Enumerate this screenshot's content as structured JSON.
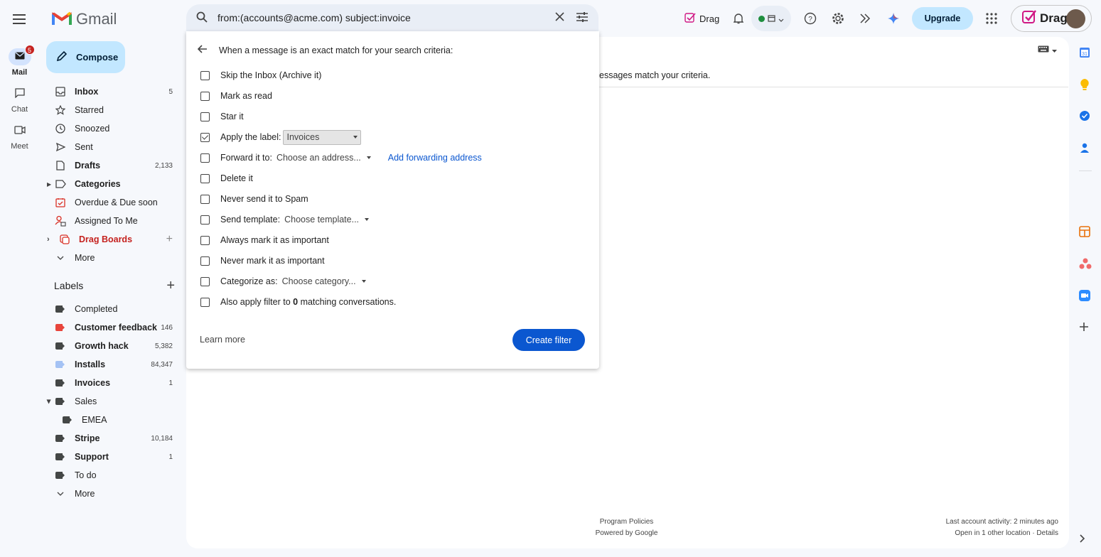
{
  "app": {
    "name": "Gmail"
  },
  "rail": [
    {
      "label": "Mail",
      "badge": "5",
      "icon": "mail-icon"
    },
    {
      "label": "Chat",
      "icon": "chat-icon"
    },
    {
      "label": "Meet",
      "icon": "video-icon"
    }
  ],
  "compose_label": "Compose",
  "nav": [
    {
      "label": "Inbox",
      "count": "5",
      "bold": true
    },
    {
      "label": "Starred"
    },
    {
      "label": "Snoozed"
    },
    {
      "label": "Sent"
    },
    {
      "label": "Drafts",
      "count": "2,133",
      "bold": true
    },
    {
      "label": "Categories",
      "bold": true
    },
    {
      "label": "Overdue & Due soon"
    },
    {
      "label": "Assigned To Me"
    },
    {
      "label": "Drag Boards"
    },
    {
      "label": "More"
    }
  ],
  "labels_header": "Labels",
  "labels": [
    {
      "label": "Completed",
      "color": "#444746"
    },
    {
      "label": "Customer feedback",
      "count": "146",
      "color": "#e8453c",
      "bold": true
    },
    {
      "label": "Growth hack",
      "count": "5,382",
      "color": "#444746",
      "bold": true
    },
    {
      "label": "Installs",
      "count": "84,347",
      "color": "#a4c2f4",
      "bold": true
    },
    {
      "label": "Invoices",
      "count": "1",
      "color": "#444746",
      "bold": true
    },
    {
      "label": "Sales",
      "color": "#444746"
    },
    {
      "label": "EMEA",
      "color": "#444746"
    },
    {
      "label": "Stripe",
      "count": "10,184",
      "color": "#444746",
      "bold": true
    },
    {
      "label": "Support",
      "count": "1",
      "color": "#444746",
      "bold": true
    },
    {
      "label": "To do",
      "color": "#444746"
    },
    {
      "label": "More"
    }
  ],
  "search": {
    "query": "from:(accounts@acme.com) subject:invoice"
  },
  "dialog": {
    "heading": "When a message is an exact match for your search criteria:",
    "options": [
      {
        "label": "Skip the Inbox (Archive it)",
        "checked": false
      },
      {
        "label": "Mark as read",
        "checked": false
      },
      {
        "label": "Star it",
        "checked": false
      },
      {
        "label": "Apply the label:",
        "checked": true,
        "select": "Invoices"
      },
      {
        "label": "Forward it to:",
        "checked": false,
        "select": "Choose an address...",
        "link": "Add forwarding address"
      },
      {
        "label": "Delete it",
        "checked": false
      },
      {
        "label": "Never send it to Spam",
        "checked": false
      },
      {
        "label": "Send template:",
        "checked": false,
        "select": "Choose template..."
      },
      {
        "label": "Always mark it as important",
        "checked": false
      },
      {
        "label": "Never mark it as important",
        "checked": false
      },
      {
        "label": "Categorize as:",
        "checked": false,
        "select": "Choose category..."
      },
      {
        "label_pre": "Also apply filter to ",
        "label_num": "0",
        "label_post": " matching conversations.",
        "checked": false
      }
    ],
    "learn_more": "Learn more",
    "create_filter": "Create filter"
  },
  "main": {
    "partial_text": "essages match your criteria."
  },
  "header": {
    "drag_label": "Drag",
    "upgrade": "Upgrade",
    "drag_brand": "Drag"
  },
  "footer": {
    "policies": "Program Policies",
    "powered": "Powered by Google",
    "activity": "Last account activity: 2 minutes ago",
    "open_other": "Open in 1 other location · Details"
  },
  "colors": {
    "accent": "#0b57d0",
    "compose_bg": "#c2e7ff",
    "badge": "#c5221f"
  }
}
